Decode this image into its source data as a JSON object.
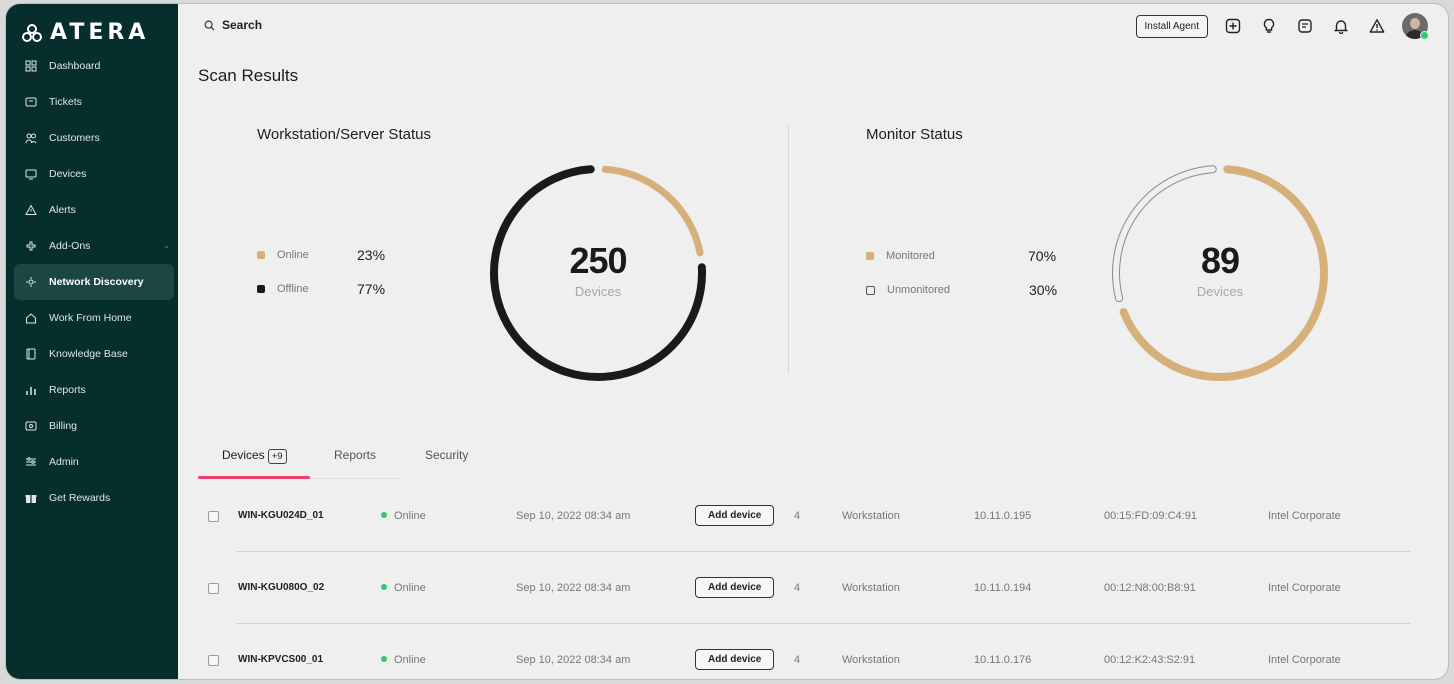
{
  "brand": {
    "name": "ATERA"
  },
  "sidebar": {
    "items": [
      {
        "label": "Dashboard",
        "icon": "dashboard-icon"
      },
      {
        "label": "Tickets",
        "icon": "ticket-icon"
      },
      {
        "label": "Customers",
        "icon": "customers-icon"
      },
      {
        "label": "Devices",
        "icon": "monitor-icon"
      },
      {
        "label": "Alerts",
        "icon": "alert-icon"
      },
      {
        "label": "Add-Ons",
        "icon": "addons-icon"
      },
      {
        "label": "Network Discovery",
        "icon": "network-icon"
      },
      {
        "label": "Work From Home",
        "icon": "home-icon"
      },
      {
        "label": "Knowledge Base",
        "icon": "book-icon"
      },
      {
        "label": "Reports",
        "icon": "reports-icon"
      },
      {
        "label": "Billing",
        "icon": "billing-icon"
      },
      {
        "label": "Admin",
        "icon": "admin-icon"
      },
      {
        "label": "Get Rewards",
        "icon": "gift-icon"
      }
    ],
    "active_index": 6
  },
  "topbar": {
    "search_label": "Search",
    "install_label": "Install Agent"
  },
  "page": {
    "title": "Scan Results"
  },
  "workstation": {
    "title": "Workstation/Server Status",
    "legend": [
      {
        "label": "Online",
        "pct": "23%",
        "value": 23,
        "color": "#d6b07a"
      },
      {
        "label": "Offline",
        "pct": "77%",
        "value": 77,
        "color": "#1a1a1a"
      }
    ],
    "total": "250",
    "total_label": "Devices"
  },
  "monitor": {
    "title": "Monitor Status",
    "legend": [
      {
        "label": "Monitored",
        "pct": "70%",
        "value": 70,
        "color": "#d6b07a"
      },
      {
        "label": "Unmonitored",
        "pct": "30%",
        "value": 30,
        "color": "#9a9a9a"
      }
    ],
    "total": "89",
    "total_label": "Devices"
  },
  "tabs": [
    {
      "label": "Devices",
      "badge": "+9"
    },
    {
      "label": "Reports"
    },
    {
      "label": "Security"
    }
  ],
  "devices": [
    {
      "name": "WIN-KGU024D_01",
      "status": "Online",
      "date": "Sep 10, 2022 08:34 am",
      "action": "Add device",
      "count": "4",
      "type": "Workstation",
      "ip": "10.11.0.195",
      "mac": "00:15:FD:09:C4:91",
      "vendor": "Intel Corporate"
    },
    {
      "name": "WIN-KGU080O_02",
      "status": "Online",
      "date": "Sep 10, 2022 08:34 am",
      "action": "Add device",
      "count": "4",
      "type": "Workstation",
      "ip": "10.11.0.194",
      "mac": "00:12:N8:00:B8:91",
      "vendor": "Intel Corporate"
    },
    {
      "name": "WIN-KPVCS00_01",
      "status": "Online",
      "date": "Sep 10, 2022 08:34 am",
      "action": "Add device",
      "count": "4",
      "type": "Workstation",
      "ip": "10.11.0.176",
      "mac": "00:12:K2:43:S2:91",
      "vendor": "Intel Corporate"
    }
  ]
}
